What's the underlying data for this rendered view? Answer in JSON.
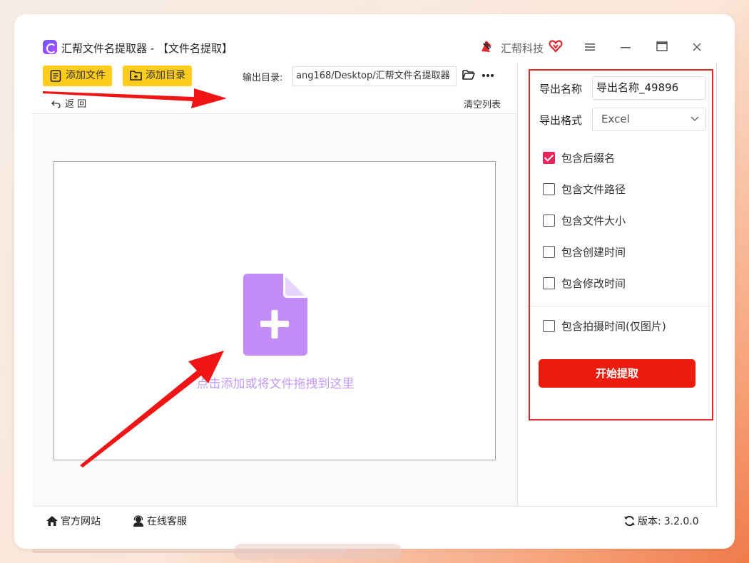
{
  "window": {
    "title": "汇帮文件名提取器 - 【文件名提取】",
    "brand_name": "汇帮科技"
  },
  "toolbar": {
    "add_file_label": "添加文件",
    "add_dir_label": "添加目录",
    "output_dir_label": "输出目录:",
    "output_dir_value": "ang168/Desktop/汇帮文件名提取器",
    "undo_label": "返 回",
    "clear_list_label": "清空列表"
  },
  "dropzone": {
    "hint": "点击添加或将文件拖拽到这里",
    "icon": "file-add-icon",
    "icon_color": "#c28df7"
  },
  "settings": {
    "export_name_label": "导出名称",
    "export_name_value": "导出名称_49896",
    "export_format_label": "导出格式",
    "export_format_value": "Excel",
    "options": [
      {
        "label": "包含后缀名",
        "checked": true
      },
      {
        "label": "包含文件路径",
        "checked": false
      },
      {
        "label": "包含文件大小",
        "checked": false
      },
      {
        "label": "包含创建时间",
        "checked": false
      },
      {
        "label": "包含修改时间",
        "checked": false
      },
      {
        "label": "包含拍摄时间(仅图片)",
        "checked": false
      }
    ],
    "start_label": "开始提取"
  },
  "footer": {
    "website_label": "官方网站",
    "support_label": "在线客服",
    "version_label": "版本:",
    "version_value": "3.2.0.0"
  },
  "colors": {
    "toolbar_button": "#ffcc1d",
    "start_button": "#ee1c0e",
    "checkbox_checked": "#e8245a",
    "annotation": "#e02a2a"
  }
}
